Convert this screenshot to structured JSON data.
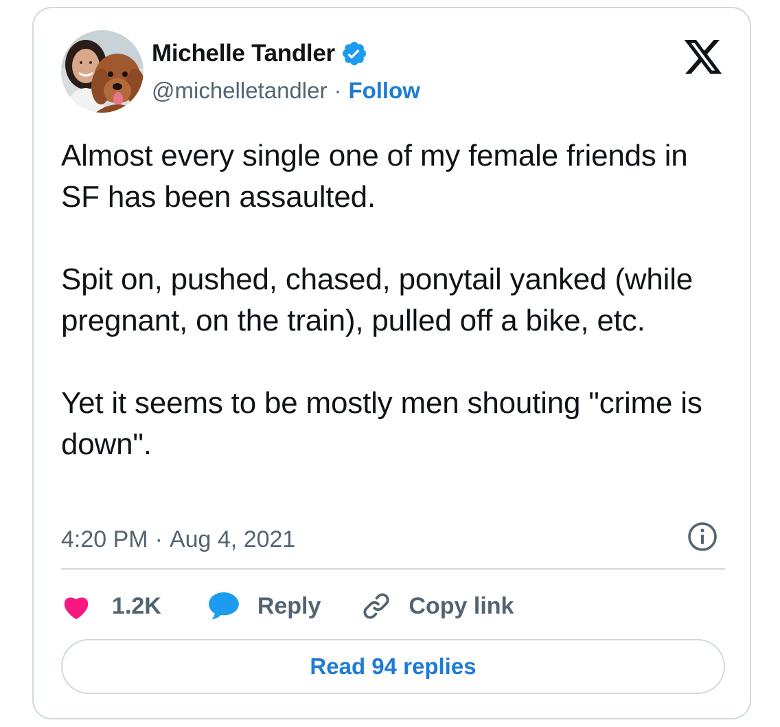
{
  "author": {
    "display_name": "Michelle Tandler",
    "handle": "@michelletandler",
    "separator": "·",
    "follow_label": "Follow",
    "verified_icon": "verified-badge-icon",
    "avatar_icon": "profile-photo"
  },
  "brand_icon": "x-logo-icon",
  "tweet": {
    "paragraphs": [
      "Almost every single one of my female friends in SF has been assaulted.",
      "Spit on, pushed, chased, ponytail yanked (while pregnant, on the train), pulled off a bike, etc.",
      "Yet it seems to be mostly men shouting \"crime is down\"."
    ],
    "time": "4:20 PM",
    "separator": "·",
    "date": "Aug 4, 2021",
    "info_icon": "info-icon"
  },
  "actions": {
    "like_count": "1.2K",
    "like_icon": "heart-icon",
    "reply_label": "Reply",
    "reply_icon": "speech-bubble-icon",
    "copy_label": "Copy link",
    "copy_icon": "link-icon"
  },
  "read_replies_label": "Read 94 replies",
  "colors": {
    "text": "#0f1419",
    "secondary": "#536471",
    "link": "#1d7bd6",
    "verified": "#1d9bf0",
    "like": "#f91880",
    "reply": "#1d9bf0",
    "border": "#cfd9de"
  }
}
